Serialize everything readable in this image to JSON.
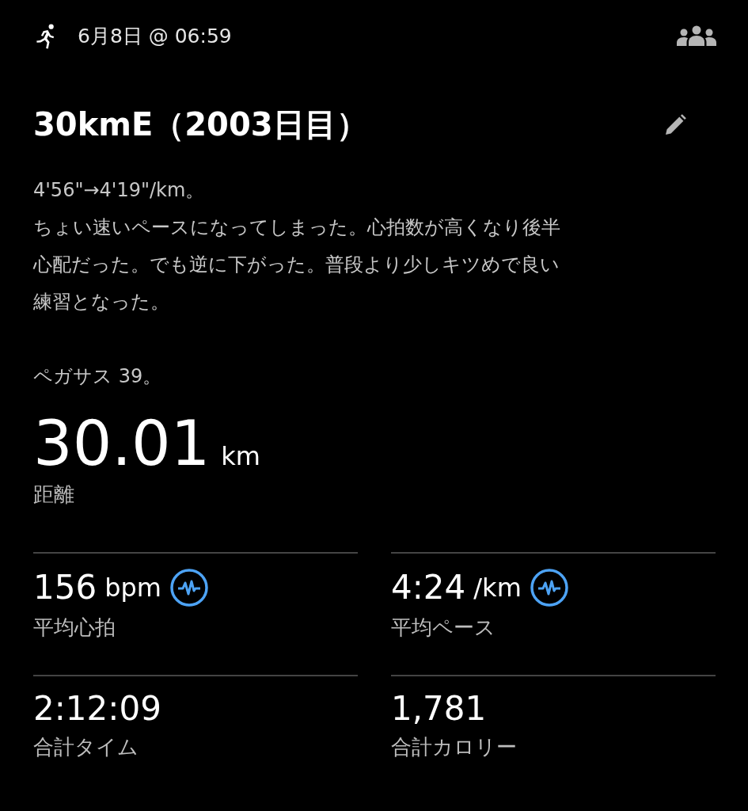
{
  "header": {
    "datetime": "6月8日 @ 06:59"
  },
  "title": "30kmE（2003日目）",
  "description": [
    [
      "4'56\"→4'19\"/km。",
      "ちょい速いペースになってしまった。心拍数が高くなり後半",
      "心配だった。でも逆に下がった。普段より少しキツめで良い",
      "練習となった。"
    ],
    [
      "ペガサス 39。"
    ]
  ],
  "distance": {
    "value": "30.01",
    "unit": "km",
    "label": "距離"
  },
  "stats": [
    {
      "value": "156",
      "unit": "bpm",
      "label": "平均心拍",
      "chart_icon": true
    },
    {
      "value": "4:24",
      "unit": "/km",
      "label": "平均ペース",
      "chart_icon": true
    },
    {
      "value": "2:12:09",
      "label": "合計タイム",
      "chart_icon": false
    },
    {
      "value": "1,781",
      "label": "合計カロリー",
      "chart_icon": false
    }
  ]
}
